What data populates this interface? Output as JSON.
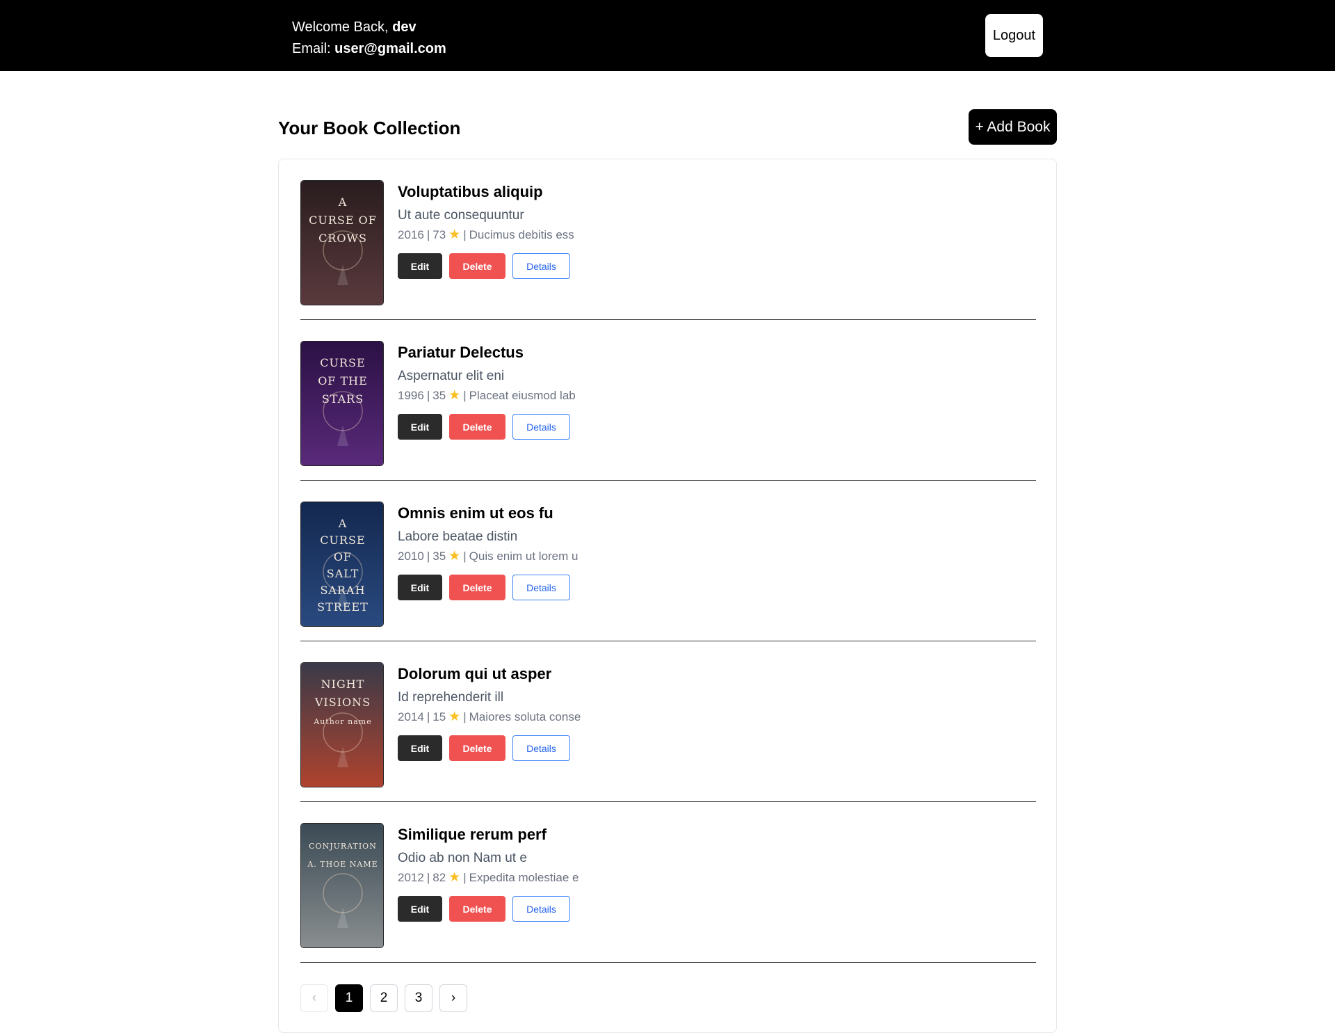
{
  "header": {
    "welcome_prefix": "Welcome Back, ",
    "username": "dev",
    "email_prefix": "Email: ",
    "email": "user@gmail.com",
    "logout_label": "Logout"
  },
  "main": {
    "title": "Your Book Collection",
    "add_book_label": "+ Add Book"
  },
  "books": [
    {
      "title": "Voluptatibus aliquip",
      "subtitle": "Ut aute consequuntur",
      "year": "2016",
      "rating": "73",
      "genre": "Ducimus debitis ess",
      "cover_text": [
        "A",
        "CURSE OF",
        "CROWS"
      ],
      "cover_colors": [
        "#2a1d1f",
        "#5a3a3d"
      ]
    },
    {
      "title": "Pariatur Delectus",
      "subtitle": "Aspernatur elit eni",
      "year": "1996",
      "rating": "35",
      "genre": "Placeat eiusmod lab",
      "cover_text": [
        "CURSE",
        "OF THE",
        "STARS"
      ],
      "cover_colors": [
        "#2b1145",
        "#5a2a7a"
      ]
    },
    {
      "title": "Omnis enim ut eos fu",
      "subtitle": "Labore beatae distin",
      "year": "2010",
      "rating": "35",
      "genre": "Quis enim ut lorem u",
      "cover_text": [
        "A",
        "CURSE",
        "OF",
        "SALT",
        "SARAH",
        "STREET"
      ],
      "cover_colors": [
        "#13284f",
        "#2a4a80"
      ]
    },
    {
      "title": "Dolorum qui ut asper",
      "subtitle": "Id reprehenderit ill",
      "year": "2014",
      "rating": "15",
      "genre": "Maiores soluta conse",
      "cover_text": [
        "NIGHT",
        "VISIONS",
        "Author name"
      ],
      "cover_colors": [
        "#3a3a48",
        "#b0432e"
      ]
    },
    {
      "title": "Similique rerum perf",
      "subtitle": "Odio ab non Nam ut e",
      "year": "2012",
      "rating": "82",
      "genre": "Expedita molestiae e",
      "cover_text": [
        "CONJURATION",
        "A. THOE NAME"
      ],
      "cover_colors": [
        "#3b4a55",
        "#8a8f90"
      ]
    }
  ],
  "labels": {
    "edit": "Edit",
    "delete": "Delete",
    "details": "Details",
    "separator": "|"
  },
  "pagination": {
    "prev_icon": "‹",
    "next_icon": "›",
    "pages": [
      "1",
      "2",
      "3"
    ],
    "current": "1"
  },
  "colors": {
    "header_bg": "#000000",
    "delete": "#f05252",
    "edit": "#2b2b2b",
    "details": "#2563eb",
    "star": "#fbbf24"
  }
}
